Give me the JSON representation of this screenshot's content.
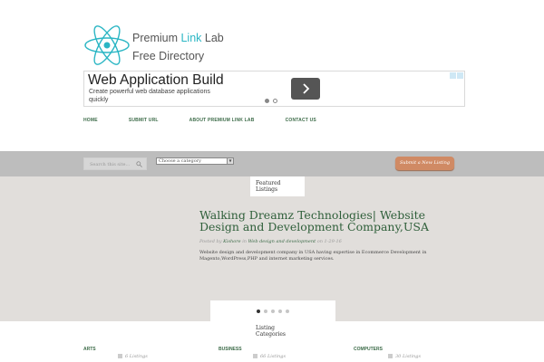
{
  "logo": {
    "line1_a": "Premium ",
    "line1_accent": "Link",
    "line1_b": " Lab",
    "line2": "Free Directory"
  },
  "ad": {
    "title": "Web Application Build",
    "description": "Create powerful web database applications quickly",
    "next_icon": "chevron-right-icon"
  },
  "nav": [
    "HOME",
    "SUBMIT URL",
    "ABOUT PREMIUM LINK LAB",
    "CONTACT US"
  ],
  "search": {
    "placeholder": "Search this site...",
    "icon": "search-icon"
  },
  "category_select": {
    "selected": "Choose a category"
  },
  "submit_button": "Submit a New Listing",
  "featured": {
    "tab_label_1": "Featured",
    "tab_label_2": "Listings",
    "headline": "Walking Dreamz Technologies| Website Design and Development Company,USA",
    "meta_posted": "Posted by",
    "meta_author": "Kishore",
    "meta_in": "in",
    "meta_category": "Web design and development",
    "meta_on": "on",
    "meta_date": "1-29-16",
    "excerpt": "Website design and development company in USA having expertise in Ecommerce Development in Magento,WordPress,PHP and internet marketing services."
  },
  "pager": {
    "active_index": 0,
    "count": 5
  },
  "listing_categories": {
    "tab_label_1": "Listing",
    "tab_label_2": "Categories"
  },
  "categories": [
    {
      "name": "ARTS",
      "count": "6 Listings"
    },
    {
      "name": "BUSINESS",
      "count": "66 Listings"
    },
    {
      "name": "COMPUTERS",
      "count": "30 Listings"
    }
  ],
  "colors": {
    "accent": "#2bb6c4",
    "link_green": "#3c6b48",
    "submit": "#d08a64",
    "band": "#bdbdbd",
    "featured_bg": "#e1dedb"
  }
}
